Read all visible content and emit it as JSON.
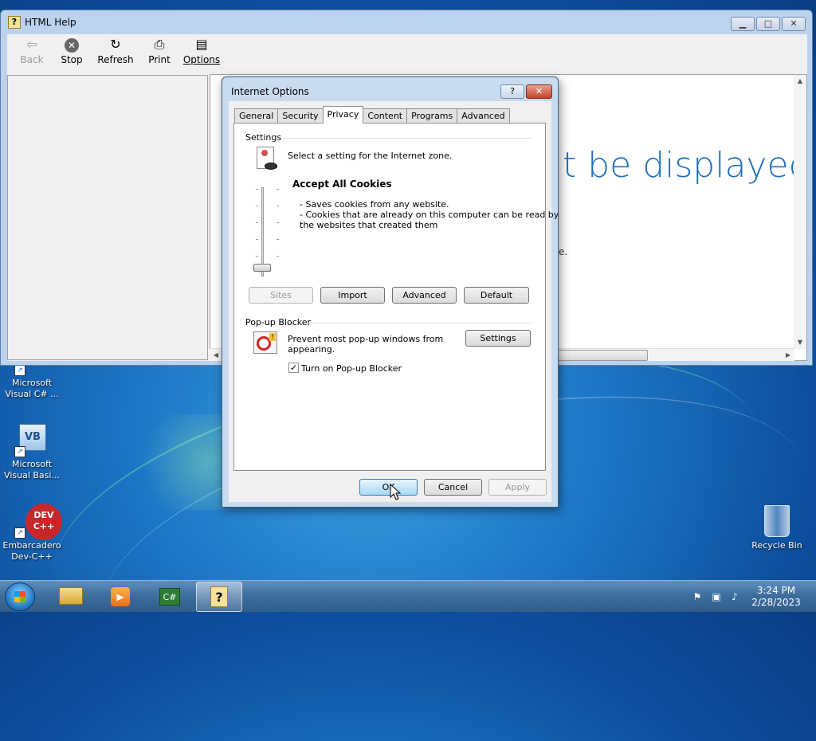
{
  "desktop": {
    "icons": [
      {
        "label": "Microsoft Visual C# ...",
        "line1": "Microsoft",
        "line2": "Visual C# ..."
      },
      {
        "label": "Microsoft Visual Basi...",
        "line1": "Microsoft",
        "line2": "Visual Basi..."
      },
      {
        "label": "Embarcadero Dev-C++",
        "line1": "Embarcadero",
        "line2": "Dev-C++",
        "badge": "DEV C++"
      },
      {
        "label": "Recycle Bin"
      }
    ],
    "vb_badge": "VB"
  },
  "help_window": {
    "title": "HTML Help",
    "toolbar": {
      "back": "Back",
      "stop": "Stop",
      "refresh": "Refresh",
      "print": "Print",
      "options": "Options"
    },
    "content_heading_fragment": "t be displayed",
    "content_text_fragment": "e."
  },
  "dialog": {
    "title": "Internet Options",
    "help_glyph": "?",
    "tabs": [
      "General",
      "Security",
      "Privacy",
      "Content",
      "Programs",
      "Advanced"
    ],
    "active_tab": "Privacy",
    "settings": {
      "group_label": "Settings",
      "instruction": "Select a setting for the Internet zone.",
      "level_title": "Accept All Cookies",
      "desc_line1": "- Saves cookies from any website.",
      "desc_line2": "- Cookies that are already on this computer can be read by",
      "desc_line3": "the websites that created them",
      "buttons": {
        "sites": "Sites",
        "import": "Import",
        "advanced": "Advanced",
        "default": "Default"
      }
    },
    "popup": {
      "group_label": "Pop-up Blocker",
      "text_line1": "Prevent most pop-up windows from",
      "text_line2": "appearing.",
      "settings_button": "Settings",
      "checkbox_label": "Turn on Pop-up Blocker",
      "checkbox_checked": true
    },
    "footer": {
      "ok": "OK",
      "cancel": "Cancel",
      "apply": "Apply"
    }
  },
  "taskbar": {
    "clock_time": "3:24 PM",
    "clock_date": "2/28/2023"
  },
  "colors": {
    "accent": "#1f6fbe",
    "close_red": "#c8432b"
  }
}
